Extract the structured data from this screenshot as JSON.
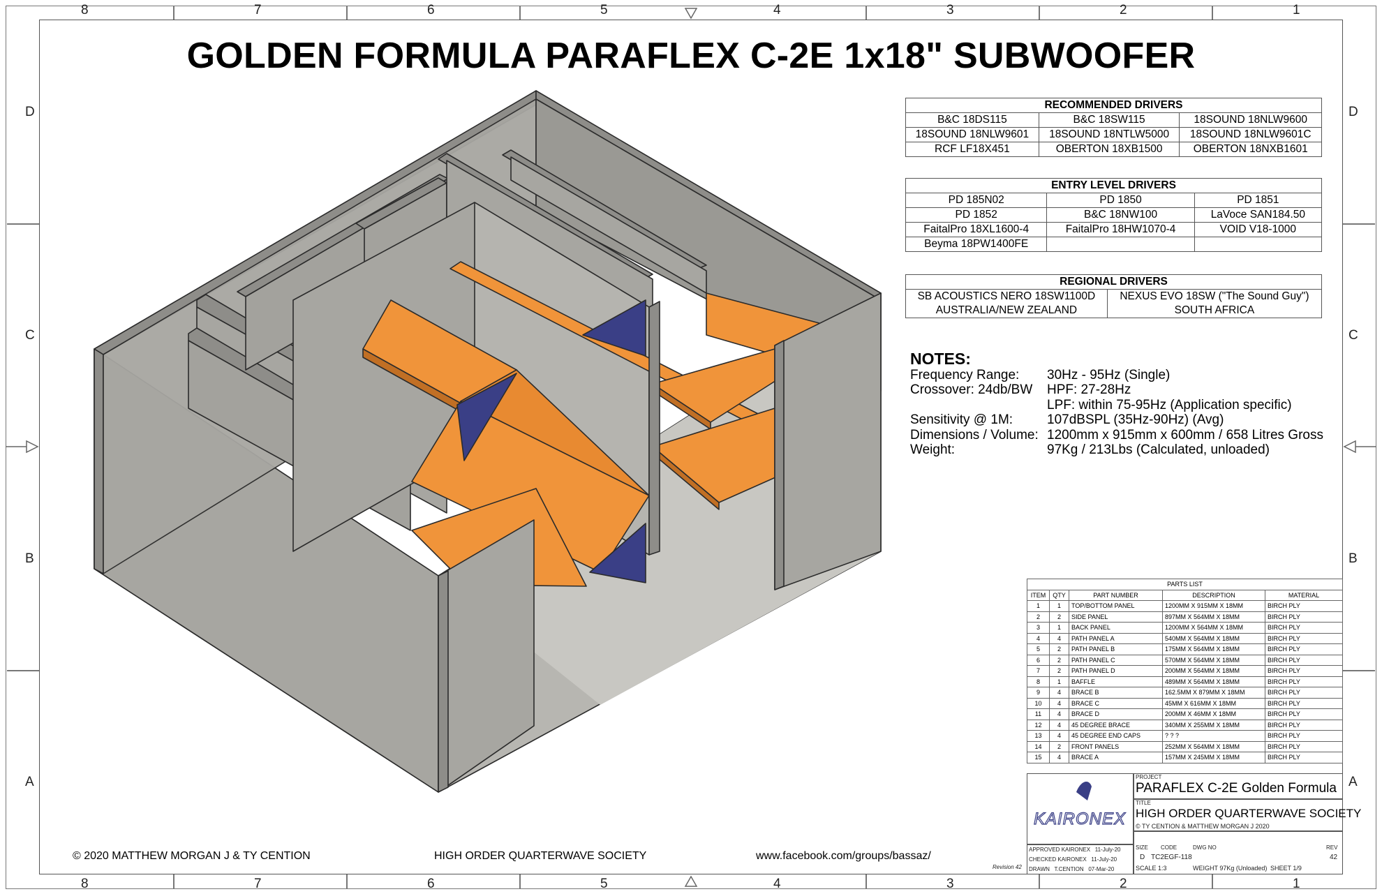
{
  "zones_top": [
    "8",
    "7",
    "6",
    "5",
    "4",
    "3",
    "2",
    "1"
  ],
  "zones_side": [
    "D",
    "C",
    "B",
    "A"
  ],
  "title": "GOLDEN FORMULA PARAFLEX C-2E 1x18\" SUBWOOFER",
  "recommended": {
    "heading": "RECOMMENDED DRIVERS",
    "rows": [
      [
        "B&C 18DS115",
        "B&C 18SW115",
        "18SOUND 18NLW9600"
      ],
      [
        "18SOUND 18NLW9601",
        "18SOUND 18NTLW5000",
        "18SOUND 18NLW9601C"
      ],
      [
        "RCF LF18X451",
        "OBERTON 18XB1500",
        "OBERTON 18NXB1601"
      ]
    ]
  },
  "entry": {
    "heading": "ENTRY LEVEL DRIVERS",
    "rows": [
      [
        "PD 185N02",
        "PD 1850",
        "PD 1851"
      ],
      [
        "PD 1852",
        "B&C 18NW100",
        "LaVoce SAN184.50"
      ],
      [
        "FaitalPro 18XL1600-4",
        "FaitalPro 18HW1070-4",
        "VOID V18-1000"
      ],
      [
        "Beyma 18PW1400FE",
        "",
        ""
      ]
    ]
  },
  "regional": {
    "heading": "REGIONAL DRIVERS",
    "cells": [
      [
        "SB ACOUSTICS NERO 18SW1100D",
        "AUSTRALIA/NEW ZEALAND"
      ],
      [
        "NEXUS EVO 18SW (\"The Sound Guy\")",
        "SOUTH AFRICA"
      ]
    ]
  },
  "notes": {
    "title": "NOTES:",
    "rows": [
      [
        "Frequency Range:",
        "30Hz - 95Hz (Single)"
      ],
      [
        "Crossover: 24db/BW",
        "HPF: 27-28Hz"
      ],
      [
        "",
        "LPF: within 75-95Hz (Application specific)"
      ],
      [
        "Sensitivity @ 1M:",
        "107dBSPL (35Hz-90Hz) (Avg)"
      ],
      [
        "Dimensions / Volume:",
        "1200mm x 915mm x 600mm / 658 Litres Gross"
      ],
      [
        "Weight:",
        "97Kg / 213Lbs (Calculated, unloaded)"
      ]
    ]
  },
  "parts": {
    "title": "PARTS LIST",
    "headers": [
      "ITEM",
      "QTY",
      "PART NUMBER",
      "DESCRIPTION",
      "MATERIAL"
    ],
    "rows": [
      [
        "1",
        "1",
        "TOP/BOTTOM PANEL",
        "1200MM X 915MM X 18MM",
        "BIRCH PLY"
      ],
      [
        "2",
        "2",
        "SIDE PANEL",
        "897MM X 564MM X 18MM",
        "BIRCH PLY"
      ],
      [
        "3",
        "1",
        "BACK PANEL",
        "1200MM X 564MM X 18MM",
        "BIRCH PLY"
      ],
      [
        "4",
        "4",
        "PATH PANEL A",
        "540MM X 564MM X 18MM",
        "BIRCH PLY"
      ],
      [
        "5",
        "2",
        "PATH PANEL B",
        "175MM X 564MM X 18MM",
        "BIRCH PLY"
      ],
      [
        "6",
        "2",
        "PATH PANEL C",
        "570MM X 564MM X 18MM",
        "BIRCH PLY"
      ],
      [
        "7",
        "2",
        "PATH PANEL D",
        "200MM X 564MM X 18MM",
        "BIRCH PLY"
      ],
      [
        "8",
        "1",
        "BAFFLE",
        "489MM X 564MM X 18MM",
        "BIRCH PLY"
      ],
      [
        "9",
        "4",
        "BRACE B",
        "162.5MM X 879MM X 18MM",
        "BIRCH PLY"
      ],
      [
        "10",
        "4",
        "BRACE C",
        "45MM X 616MM X 18MM",
        "BIRCH PLY"
      ],
      [
        "11",
        "4",
        "BRACE D",
        "200MM X 46MM X 18MM",
        "BIRCH PLY"
      ],
      [
        "12",
        "4",
        "45 DEGREE BRACE",
        "340MM X 255MM X 18MM",
        "BIRCH PLY"
      ],
      [
        "13",
        "4",
        "45 DEGREE END CAPS",
        "? ? ?",
        "BIRCH PLY"
      ],
      [
        "14",
        "2",
        "FRONT PANELS",
        "252MM X 564MM X 18MM",
        "BIRCH PLY"
      ],
      [
        "15",
        "4",
        "BRACE A",
        "157MM X 245MM X 18MM",
        "BIRCH PLY"
      ]
    ]
  },
  "titleblock": {
    "logo": "KAIRONEX",
    "project_label": "PROJECT",
    "project": "PARAFLEX C-2E Golden Formula",
    "title_label": "TITLE",
    "title": "HIGH ORDER QUARTERWAVE SOCIETY",
    "copyright": "© TY CENTION & MATTHEW MORGAN J 2020",
    "approved": [
      "APPROVED",
      "KAIRONEX",
      "11-July-20"
    ],
    "checked": [
      "CHECKED",
      "KAIRONEX",
      "11-July-20"
    ],
    "drawn": [
      "DRAWN",
      "T.CENTION",
      "07-Mar-20"
    ],
    "size_label": "SIZE",
    "size": "D",
    "code_label": "CODE",
    "code": "TC2EGF-118",
    "dwg_label": "DWG NO",
    "rev_label": "REV",
    "rev": "42",
    "scale": "SCALE  1:3",
    "weight": "WEIGHT 97Kg (Unloaded)",
    "sheet": "SHEET  1/9",
    "revision": "Revision 42"
  },
  "footer": {
    "left": "© 2020 MATTHEW MORGAN J & TY CENTION",
    "middle": "HIGH ORDER QUARTERWAVE SOCIETY",
    "right": "www.facebook.com/groups/bassaz/"
  },
  "colors": {
    "wood": "#a7a6a1",
    "orange": "#f0943a",
    "blue": "#3a3f86"
  }
}
